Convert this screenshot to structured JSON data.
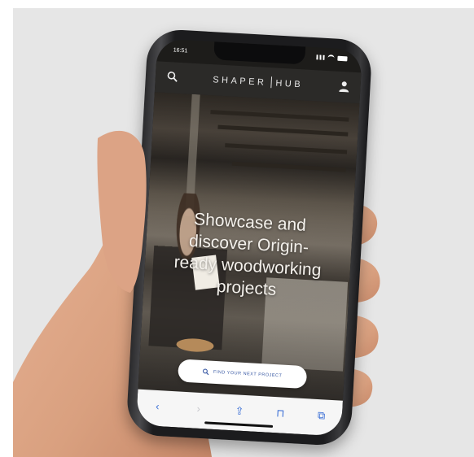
{
  "status_bar": {
    "time": "16:51"
  },
  "navbar": {
    "brand_left": "SHAPER",
    "brand_right": "HUB",
    "search_icon": "search-icon",
    "user_icon": "user-icon"
  },
  "hero": {
    "headline": "Showcase and\ndiscover Origin-\nready woodworking\nprojects",
    "cta_label": "FIND YOUR NEXT PROJECT",
    "cta_icon": "search-icon"
  },
  "toolbar": {
    "items": [
      "back-icon",
      "forward-icon",
      "share-icon",
      "bookmarks-icon",
      "tabs-icon"
    ],
    "glyphs": [
      "‹",
      "›",
      "⇪",
      "⊓",
      "⧉"
    ]
  },
  "colors": {
    "accent": "#3b5ba5",
    "navbar": "#2b2a28",
    "safari_blue": "#3b6fd6"
  }
}
